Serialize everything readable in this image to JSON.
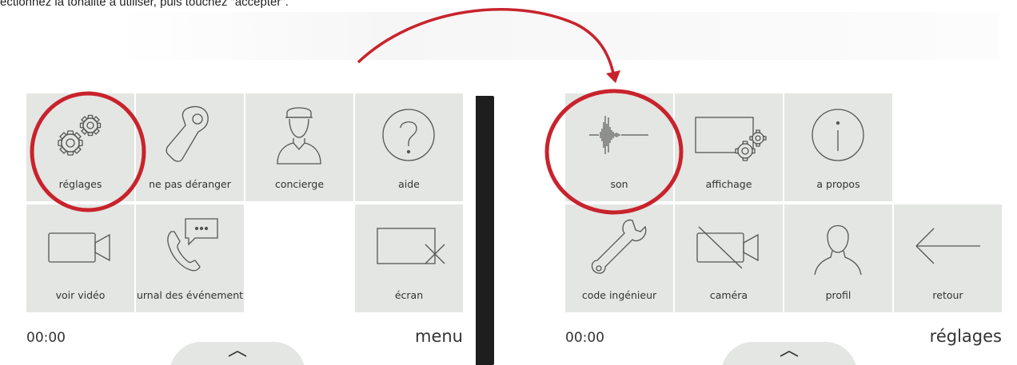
{
  "instruction": "ectionnez la tonalité à utiliser, puis touchez \"accepter\".",
  "colors": {
    "accent": "#c8232c",
    "tile": "#e4e6e3",
    "frame": "#1e1e1e",
    "icon": "#555555"
  },
  "left_screen": {
    "time": "00:00",
    "title": "menu",
    "tiles": [
      {
        "label": "réglages",
        "icon": "gears-icon",
        "highlighted": true
      },
      {
        "label": "ne pas déranger",
        "icon": "door-hanger-icon"
      },
      {
        "label": "concierge",
        "icon": "concierge-icon"
      },
      {
        "label": "aide",
        "icon": "help-icon"
      },
      {
        "label": "voir vidéo",
        "icon": "video-camera-icon"
      },
      {
        "label": "urnal des événement",
        "icon": "call-log-icon"
      },
      {
        "label": "écran",
        "icon": "screen-off-icon"
      }
    ]
  },
  "right_screen": {
    "time": "00:00",
    "title": "réglages",
    "tiles": [
      {
        "label": "son",
        "icon": "sound-wave-icon",
        "highlighted": true
      },
      {
        "label": "affichage",
        "icon": "display-settings-icon"
      },
      {
        "label": "a propos",
        "icon": "info-icon"
      },
      {
        "label": "code ingénieur",
        "icon": "wrench-icon"
      },
      {
        "label": "caméra",
        "icon": "camera-off-icon"
      },
      {
        "label": "profil",
        "icon": "profile-icon"
      },
      {
        "label": "retour",
        "icon": "back-arrow-icon"
      }
    ]
  }
}
